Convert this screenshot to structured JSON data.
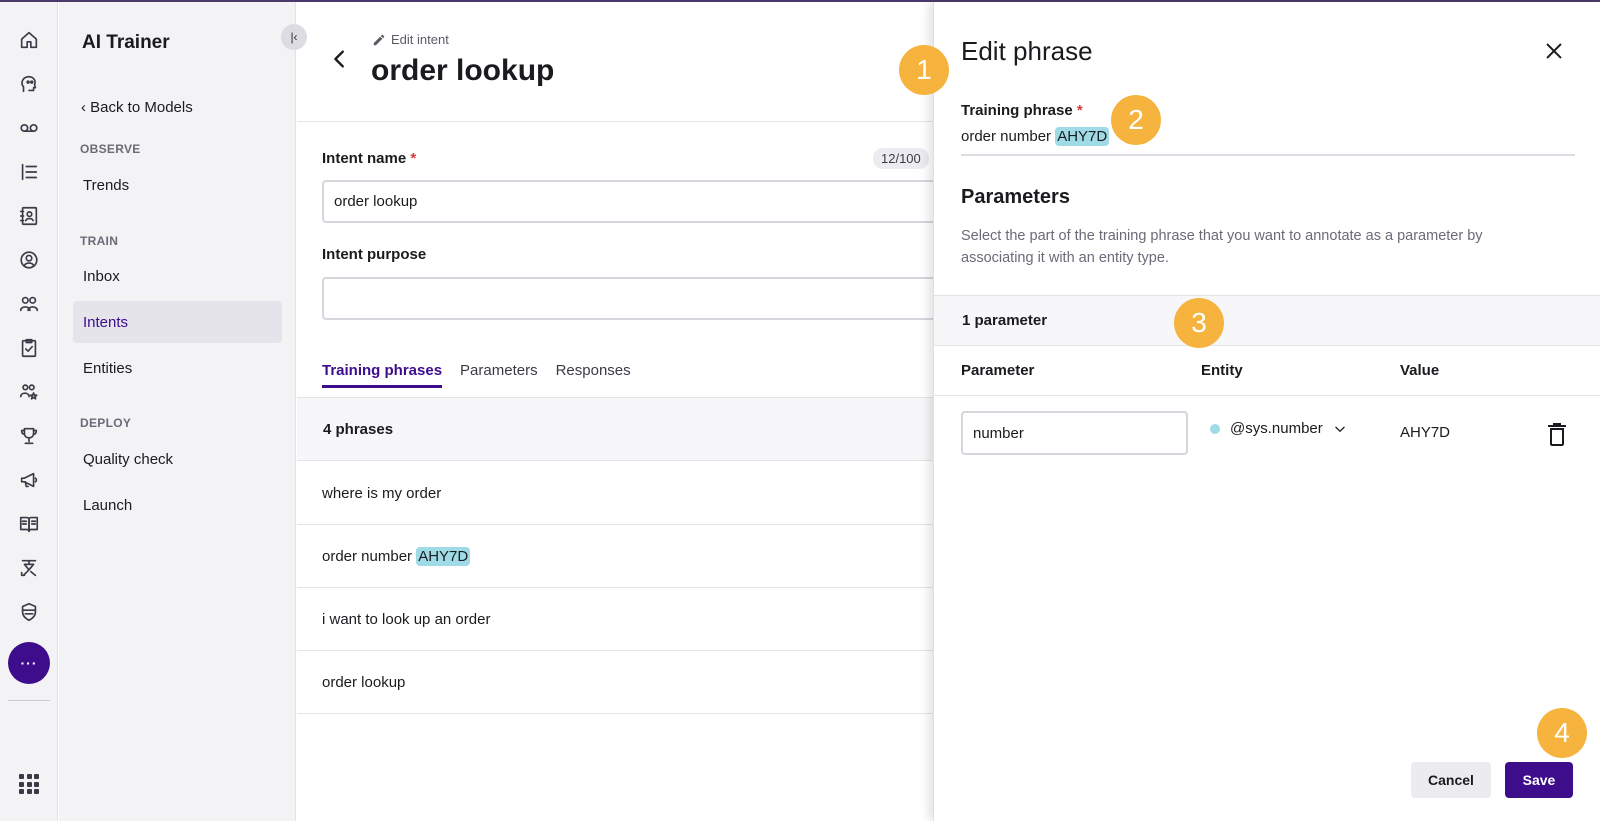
{
  "app": {
    "title": "AI Trainer"
  },
  "nav": {
    "back_label": "Back to Models",
    "sections": [
      {
        "label": "OBSERVE",
        "items": [
          "Trends"
        ]
      },
      {
        "label": "TRAIN",
        "items": [
          "Inbox",
          "Intents",
          "Entities"
        ]
      },
      {
        "label": "DEPLOY",
        "items": [
          "Quality check",
          "Launch"
        ]
      }
    ],
    "active_item": "Intents",
    "more_label": "···"
  },
  "rail_icons": [
    "home-icon",
    "speech-bubble-head-icon",
    "voicemail-icon",
    "list-icon",
    "contacts-book-icon",
    "agent-icon",
    "people-icon",
    "clipboard-check-icon",
    "people-star-icon",
    "trophy-icon",
    "megaphone-icon",
    "book-open-icon",
    "flow-icon",
    "shield-icon",
    "apps-grid-icon"
  ],
  "main": {
    "breadcrumb": "Edit intent",
    "title": "order lookup",
    "intent_name_label": "Intent name",
    "intent_name_required": "*",
    "intent_name_counter": "12/100",
    "intent_name_value": "order lookup",
    "intent_purpose_label": "Intent purpose",
    "intent_purpose_value": "",
    "tabs": [
      "Training phrases",
      "Parameters",
      "Responses"
    ],
    "active_tab": "Training phrases",
    "phrases_count": "4 phrases",
    "phrases": [
      {
        "text": "where is my order",
        "highlight": ""
      },
      {
        "text": "order number",
        "highlight": "AHY7D"
      },
      {
        "text": "i want to look up an order",
        "highlight": ""
      },
      {
        "text": "order lookup",
        "highlight": ""
      }
    ]
  },
  "panel": {
    "title": "Edit phrase",
    "training_phrase_label": "Training phrase",
    "required_mark": "*",
    "training_phrase_text": "order number",
    "training_phrase_highlight": "AHY7D",
    "parameters_title": "Parameters",
    "parameters_description": "Select the part of the training phrase that you want to annotate as a parameter by associating it with an entity type.",
    "parameter_count": "1 parameter",
    "columns": {
      "parameter": "Parameter",
      "entity": "Entity",
      "value": "Value"
    },
    "row": {
      "parameter": "number",
      "entity": "@sys.number",
      "value": "AHY7D"
    },
    "cancel_label": "Cancel",
    "save_label": "Save"
  },
  "markers": [
    "1",
    "2",
    "3",
    "4"
  ],
  "colors": {
    "accent": "#3d0d8c",
    "highlight": "#9fdbe6",
    "marker": "#f6b43f",
    "required": "#d63b3b",
    "rail_bg": "#f3f3f5"
  }
}
